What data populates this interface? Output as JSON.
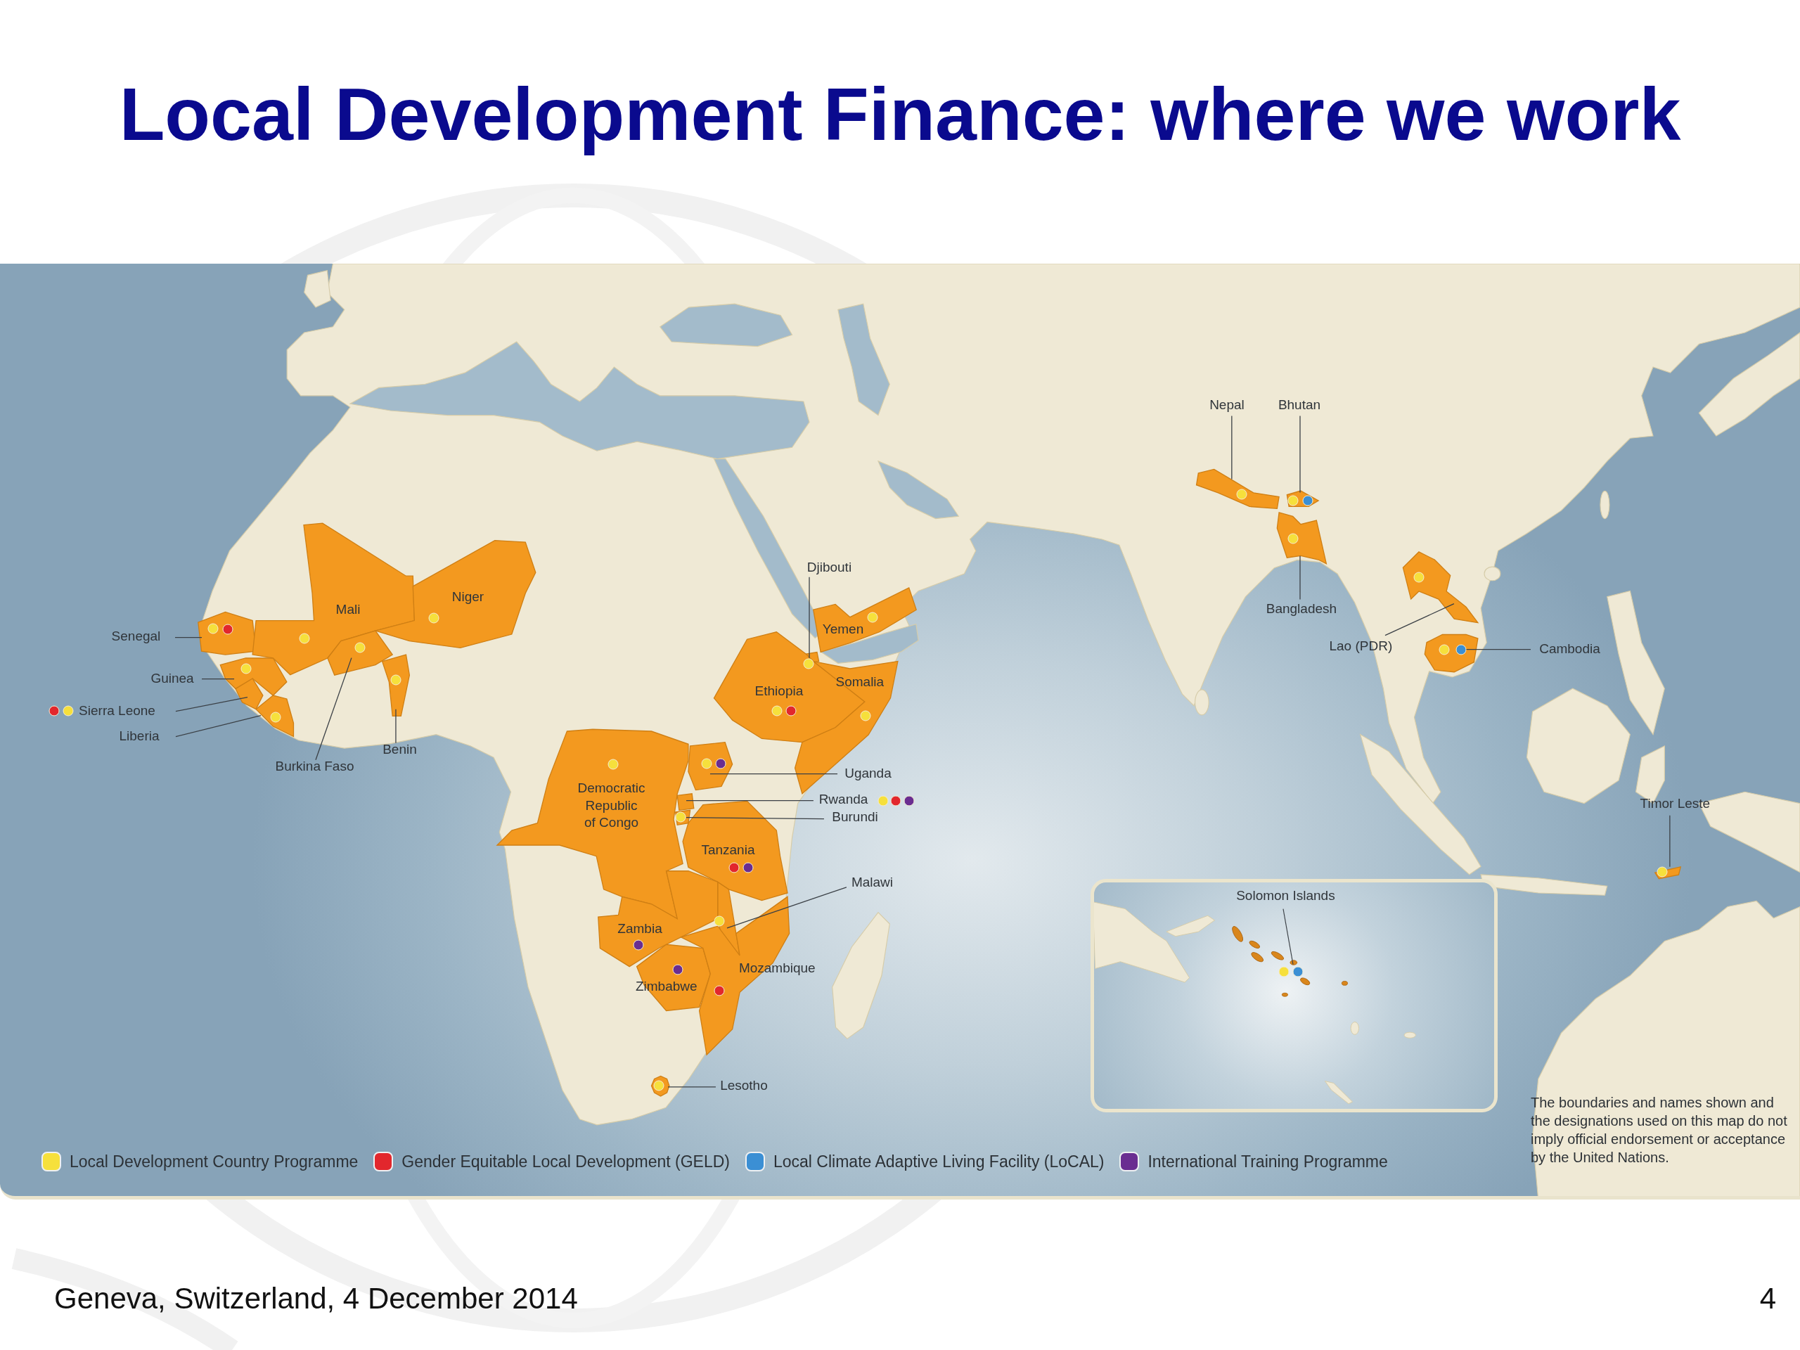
{
  "slide": {
    "title": "Local Development Finance: where we work",
    "footer": "Geneva, Switzerland, 4 December 2014",
    "page_number": "4"
  },
  "map": {
    "countries": [
      {
        "name": "Senegal",
        "markers": [
          {
            "color": "#f6e03c"
          },
          {
            "color": "#e2272d"
          }
        ]
      },
      {
        "name": "Guinea",
        "markers": [
          {
            "color": "#f6e03c"
          }
        ]
      },
      {
        "name": "Sierra Leone",
        "markers": [
          {
            "color": "#e2272d"
          },
          {
            "color": "#f6e03c"
          }
        ]
      },
      {
        "name": "Liberia",
        "markers": [
          {
            "color": "#f6e03c"
          }
        ]
      },
      {
        "name": "Mali",
        "markers": [
          {
            "color": "#f6e03c"
          }
        ]
      },
      {
        "name": "Niger",
        "markers": [
          {
            "color": "#f6e03c"
          }
        ]
      },
      {
        "name": "Burkina Faso",
        "markers": [
          {
            "color": "#f6e03c"
          }
        ]
      },
      {
        "name": "Benin",
        "markers": [
          {
            "color": "#f6e03c"
          }
        ]
      },
      {
        "name": "Djibouti",
        "markers": [
          {
            "color": "#f6e03c"
          }
        ]
      },
      {
        "name": "Yemen",
        "markers": [
          {
            "color": "#f6e03c"
          }
        ]
      },
      {
        "name": "Ethiopia",
        "markers": [
          {
            "color": "#f6e03c"
          },
          {
            "color": "#e2272d"
          }
        ]
      },
      {
        "name": "Somalia",
        "markers": [
          {
            "color": "#f6e03c"
          }
        ]
      },
      {
        "name": "Democratic\nRepublic\nof Congo",
        "markers": [
          {
            "color": "#f6e03c"
          }
        ]
      },
      {
        "name": "Uganda",
        "markers": [
          {
            "color": "#f6e03c"
          },
          {
            "color": "#6a2d91"
          }
        ]
      },
      {
        "name": "Rwanda",
        "markers": [
          {
            "color": "#f6e03c"
          },
          {
            "color": "#e2272d"
          },
          {
            "color": "#6a2d91"
          }
        ]
      },
      {
        "name": "Burundi",
        "markers": [
          {
            "color": "#f6e03c"
          }
        ]
      },
      {
        "name": "Tanzania",
        "markers": [
          {
            "color": "#e2272d"
          },
          {
            "color": "#6a2d91"
          }
        ]
      },
      {
        "name": "Malawi",
        "markers": [
          {
            "color": "#f6e03c"
          }
        ]
      },
      {
        "name": "Zambia",
        "markers": [
          {
            "color": "#6a2d91"
          }
        ]
      },
      {
        "name": "Zimbabwe",
        "markers": [
          {
            "color": "#6a2d91"
          }
        ]
      },
      {
        "name": "Mozambique",
        "markers": [
          {
            "color": "#e2272d"
          }
        ]
      },
      {
        "name": "Lesotho",
        "markers": [
          {
            "color": "#f6e03c"
          }
        ]
      },
      {
        "name": "Nepal",
        "markers": [
          {
            "color": "#f6e03c"
          }
        ]
      },
      {
        "name": "Bhutan",
        "markers": [
          {
            "color": "#f6e03c"
          },
          {
            "color": "#3b8fd4"
          }
        ]
      },
      {
        "name": "Bangladesh",
        "markers": [
          {
            "color": "#f6e03c"
          }
        ]
      },
      {
        "name": "Lao (PDR)",
        "markers": [
          {
            "color": "#f6e03c"
          }
        ]
      },
      {
        "name": "Cambodia",
        "markers": [
          {
            "color": "#f6e03c"
          },
          {
            "color": "#3b8fd4"
          }
        ]
      },
      {
        "name": "Timor Leste",
        "markers": [
          {
            "color": "#f6e03c"
          }
        ]
      }
    ],
    "inset": {
      "countries": [
        {
          "name": "Solomon Islands",
          "markers": [
            {
              "color": "#f6e03c"
            },
            {
              "color": "#3b8fd4"
            }
          ]
        }
      ]
    },
    "legend": [
      {
        "label": "Local Development Country Programme",
        "color": "#f6e03c"
      },
      {
        "label": "Gender Equitable Local Development (GELD)",
        "color": "#e2272d"
      },
      {
        "label": "Local Climate Adaptive Living Facility (LoCAL)",
        "color": "#3b8fd4"
      },
      {
        "label": "International Training Programme",
        "color": "#6a2d91"
      }
    ],
    "disclaimer": "The boundaries and names shown and the designations used on this map do not imply official endorsement or acceptance by the United Nations."
  }
}
